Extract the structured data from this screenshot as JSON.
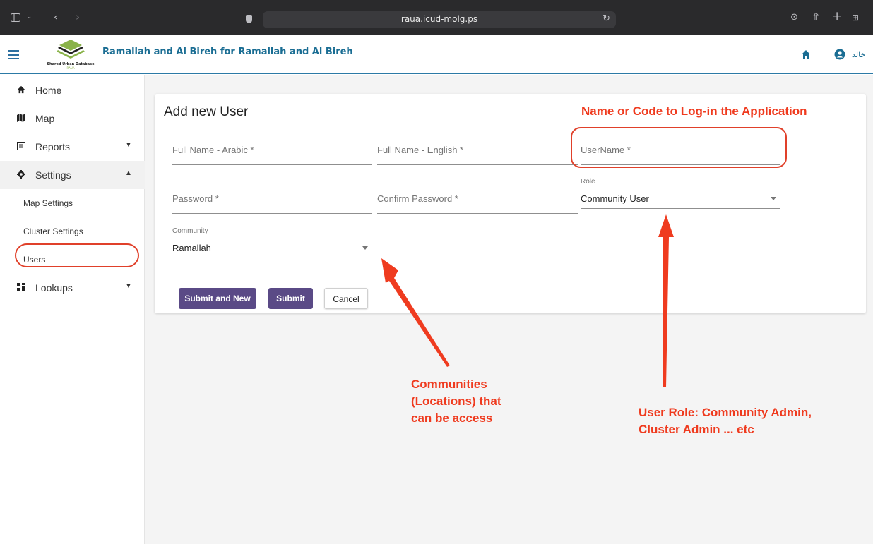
{
  "browser": {
    "url": "raua.icud-molg.ps"
  },
  "header": {
    "title": "Ramallah and Al Bireh for Ramallah and Al Bireh",
    "user_label": "خالد"
  },
  "sidebar": {
    "items": [
      {
        "label": "Home",
        "icon": "home-icon"
      },
      {
        "label": "Map",
        "icon": "map-icon"
      },
      {
        "label": "Reports",
        "icon": "reports-icon"
      },
      {
        "label": "Settings",
        "icon": "gear-icon"
      },
      {
        "label": "Lookups",
        "icon": "grid-icon"
      }
    ],
    "sub_items": [
      {
        "label": "Map Settings"
      },
      {
        "label": "Cluster Settings"
      },
      {
        "label": "Users"
      }
    ]
  },
  "form": {
    "title": "Add new User",
    "full_name_arabic": {
      "placeholder": "Full Name - Arabic *"
    },
    "full_name_english": {
      "placeholder": "Full Name - English *"
    },
    "username": {
      "placeholder": "UserName *"
    },
    "password": {
      "placeholder": "Password *"
    },
    "confirm_password": {
      "placeholder": "Confirm Password *"
    },
    "role": {
      "label": "Role",
      "value": "Community User"
    },
    "community": {
      "label": "Community",
      "value": "Ramallah"
    },
    "buttons": {
      "submit_new": "Submit and New",
      "submit": "Submit",
      "cancel": "Cancel"
    }
  },
  "annotations": {
    "username_note": "Name or Code to Log-in the Application",
    "community_note_line1": "Communities",
    "community_note_line2": "(Locations) that",
    "community_note_line3": "can be access",
    "role_note_line1": "User Role: Community Admin,",
    "role_note_line2": "Cluster Admin ... etc"
  },
  "colors": {
    "primary_button": "#5a4a86",
    "header_accent": "#1a6d93",
    "annotation": "#ef3b1f"
  }
}
